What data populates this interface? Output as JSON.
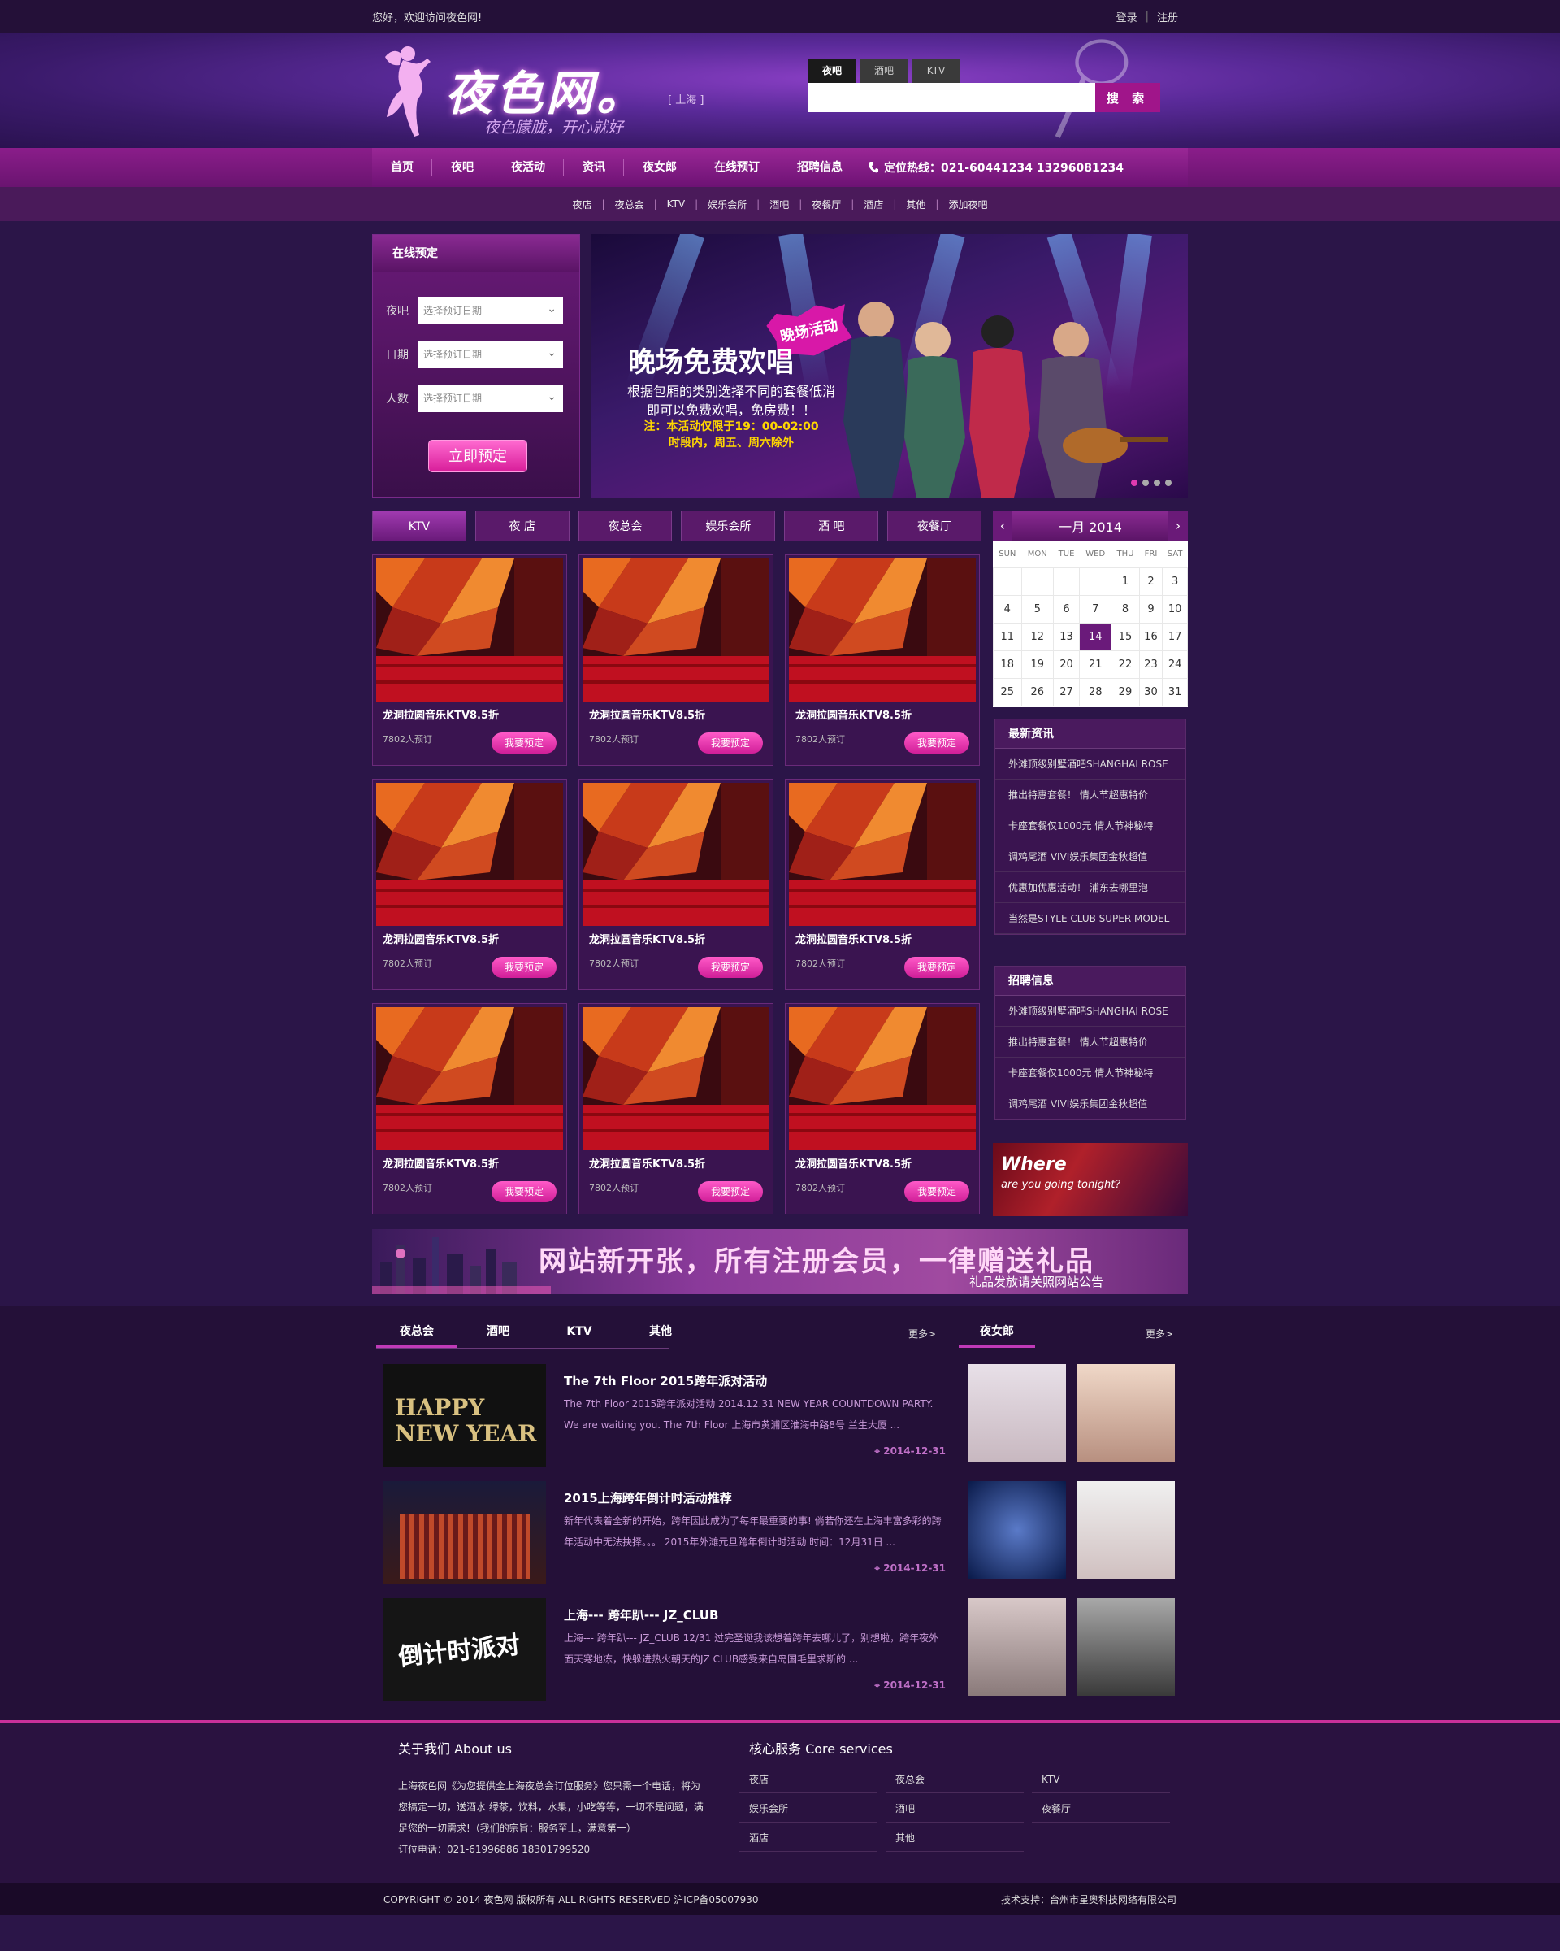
{
  "topbar": {
    "welcome": "您好，欢迎访问夜色网!",
    "login": "登录",
    "sep": "|",
    "register": "注册"
  },
  "logo": {
    "name": "夜色网。",
    "slogan": "夜色朦胧，开心就好",
    "city": "[ 上海 ]"
  },
  "search": {
    "tabs": [
      "夜吧",
      "酒吧",
      "KTV"
    ],
    "placeholder": "",
    "button": "搜 索"
  },
  "nav": {
    "items": [
      "首页",
      "夜吧",
      "夜活动",
      "资讯",
      "夜女郎",
      "在线预订",
      "招聘信息"
    ],
    "hotline": "定位热线：021-60441234  13296081234"
  },
  "subnav": {
    "items": [
      "夜店",
      "夜总会",
      "KTV",
      "娱乐会所",
      "酒吧",
      "夜餐厅",
      "酒店",
      "其他",
      "添加夜吧"
    ],
    "sep": "|"
  },
  "booking": {
    "title": "在线预定",
    "fields": [
      {
        "label": "夜吧",
        "value": "选择预订日期"
      },
      {
        "label": "日期",
        "value": "选择预订日期"
      },
      {
        "label": "人数",
        "value": "选择预订日期"
      }
    ],
    "button": "立即预定"
  },
  "banner": {
    "badge": "晚场活动",
    "title": "晚场免费欢唱",
    "line1": "根据包厢的类别选择不同的套餐低消",
    "line2": "即可以免费欢唱，免房费！！",
    "line3": "注：本活动仅限于19：00-02:00",
    "line4": "时段内，周五、周六除外"
  },
  "category_tabs": [
    "KTV",
    "夜 店",
    "夜总会",
    "娱乐会所",
    "酒 吧",
    "夜餐厅"
  ],
  "venues": [
    {
      "name": "龙洞拉圆音乐KTV8.5折",
      "count": "7802人预订",
      "button": "我要预定"
    },
    {
      "name": "龙洞拉圆音乐KTV8.5折",
      "count": "7802人预订",
      "button": "我要预定"
    },
    {
      "name": "龙洞拉圆音乐KTV8.5折",
      "count": "7802人预订",
      "button": "我要预定"
    },
    {
      "name": "龙洞拉圆音乐KTV8.5折",
      "count": "7802人预订",
      "button": "我要预定"
    },
    {
      "name": "龙洞拉圆音乐KTV8.5折",
      "count": "7802人预订",
      "button": "我要预定"
    },
    {
      "name": "龙洞拉圆音乐KTV8.5折",
      "count": "7802人预订",
      "button": "我要预定"
    },
    {
      "name": "龙洞拉圆音乐KTV8.5折",
      "count": "7802人预订",
      "button": "我要预定"
    },
    {
      "name": "龙洞拉圆音乐KTV8.5折",
      "count": "7802人预订",
      "button": "我要预定"
    },
    {
      "name": "龙洞拉圆音乐KTV8.5折",
      "count": "7802人预订",
      "button": "我要预定"
    }
  ],
  "calendar": {
    "month": "一月",
    "year": "2014",
    "prev": "‹",
    "next": "›",
    "weekdays": [
      "SUN",
      "MON",
      "TUE",
      "WED",
      "THU",
      "FRI",
      "SAT"
    ],
    "today": "14",
    "weeks": [
      [
        "",
        "",
        "",
        "",
        "1",
        "2",
        "3"
      ],
      [
        "4",
        "5",
        "6",
        "7",
        "8",
        "9",
        "10"
      ],
      [
        "11",
        "12",
        "13",
        "14",
        "15",
        "16",
        "17"
      ],
      [
        "18",
        "19",
        "20",
        "21",
        "22",
        "23",
        "24"
      ],
      [
        "25",
        "26",
        "27",
        "28",
        "29",
        "30",
        "31"
      ]
    ]
  },
  "latest_news": {
    "title": "最新资讯",
    "items": [
      "外滩顶级别墅酒吧SHANGHAI ROSE",
      "推出特惠套餐！ 情人节超惠特价",
      "卡座套餐仅1000元 情人节神秘特",
      "调鸡尾酒 VIVI娱乐集团金秋超值",
      "优惠加优惠活动！ 浦东去哪里泡",
      "当然是STYLE CLUB SUPER MODEL"
    ]
  },
  "jobs": {
    "title": "招聘信息",
    "items": [
      "外滩顶级别墅酒吧SHANGHAI ROSE",
      "推出特惠套餐！ 情人节超惠特价",
      "卡座套餐仅1000元 情人节神秘特",
      "调鸡尾酒 VIVI娱乐集团金秋超值"
    ]
  },
  "side_ad": {
    "line1": "Where",
    "line2": "are you going tonight?"
  },
  "promo": {
    "text": "网站新开张，所有注册会员，一律赠送礼品",
    "sub": "礼品发放请关照网站公告"
  },
  "news_tabs": [
    "夜总会",
    "酒吧",
    "KTV",
    "其他"
  ],
  "more": "更多>",
  "girls_tab": "夜女郎",
  "news": [
    {
      "title": "The 7th Floor 2015跨年派对活动",
      "desc": "The 7th Floor 2015跨年派对活动 2014.12.31 NEW YEAR COUNTDOWN PARTY. We are waiting you. The 7th Floor 上海市黄浦区淮海中路8号 兰生大厦 ...",
      "date": "2014-12-31",
      "img_text": "HAPPY NEW YEAR"
    },
    {
      "title": "2015上海跨年倒计时活动推荐",
      "desc": "新年代表着全新的开始，跨年因此成为了每年最重要的事! 倘若你还在上海丰富多彩的跨年活动中无法抉择。。。 2015年外滩元旦跨年倒计时活动 时间：12月31日 ...",
      "date": "2014-12-31",
      "img_text": ""
    },
    {
      "title": "上海--- 跨年趴--- JZ_CLUB",
      "desc": "上海--- 跨年趴--- JZ_CLUB 12/31 过完圣诞我该想着跨年去哪儿了，别想啦，跨年夜外面天寒地冻，快躲进热火朝天的JZ CLUB感受来自岛国毛里求斯的 ...",
      "date": "2014-12-31",
      "img_text": "倒计时派对"
    }
  ],
  "footer": {
    "about_title": "关于我们 About us",
    "about_text": "上海夜色网《为您提供全上海夜总会订位服务》您只需一个电话，将为您搞定一切，送酒水 绿茶，饮料，水果，小吃等等，一切不是问题，满足您的一切需求!（我们的宗旨：服务至上，满意第一）",
    "phone": "订位电话：021-61996886 18301799520",
    "core_title": "核心服务 Core services",
    "services": [
      "夜店",
      "夜总会",
      "KTV",
      "娱乐会所",
      "酒吧",
      "夜餐厅",
      "酒店",
      "其他"
    ]
  },
  "copyright": {
    "left": "COPYRIGHT © 2014 夜色网 版权所有 ALL RIGHTS RESERVED 沪ICP备05007930",
    "right": "技术支持：台州市星奥科技网络有限公司"
  }
}
